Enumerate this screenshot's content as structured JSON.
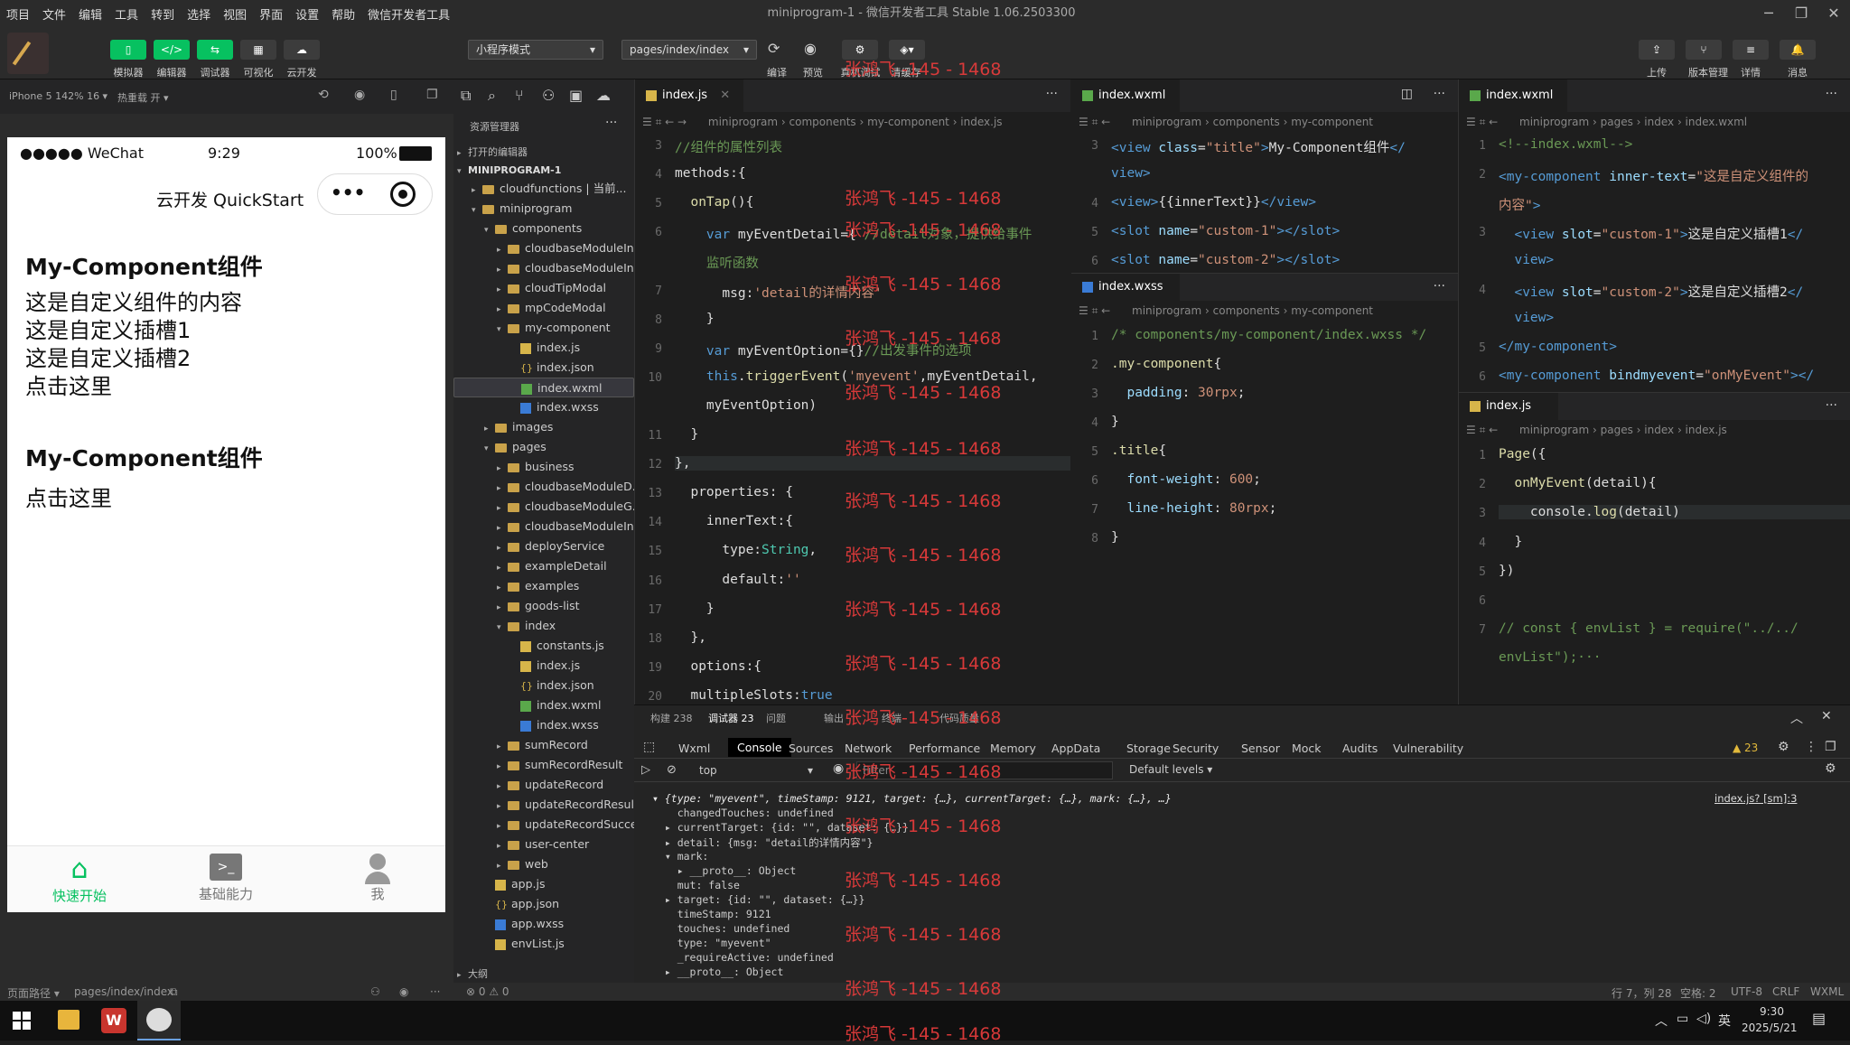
{
  "menu": [
    "项目",
    "文件",
    "编辑",
    "工具",
    "转到",
    "选择",
    "视图",
    "界面",
    "设置",
    "帮助",
    "微信开发者工具"
  ],
  "window_title": "miniprogram-1 - 微信开发者工具 Stable 1.06.2503300",
  "toolbar": {
    "simulator": "模拟器",
    "editor": "编辑器",
    "debugger": "调试器",
    "visual": "可视化",
    "cloud": "云开发",
    "mode": "小程序模式",
    "page": "pages/index/index",
    "compile": "编译",
    "preview": "预览",
    "real_debug": "真机调试",
    "clear_cache": "清缓存",
    "upload": "上传",
    "version": "版本管理",
    "details": "详情",
    "messages": "消息"
  },
  "subbar": {
    "device": "iPhone 5 142% 16 ▾",
    "hotreload": "热重载 开 ▾"
  },
  "phone": {
    "carrier": "●●●●● WeChat",
    "time": "9:29",
    "battery": "100%",
    "nav_title": "云开发 QuickStart",
    "comp1_title": "My-Component组件",
    "comp1_lines": [
      "这是自定义组件的内容",
      "这是自定义插槽1",
      "这是自定义插槽2",
      "点击这里"
    ],
    "comp2_title": "My-Component组件",
    "comp2_line": "点击这里",
    "tabs": [
      "快速开始",
      "基础能力",
      "我"
    ]
  },
  "explorer": {
    "title": "资源管理器",
    "open_editors": "打开的编辑器",
    "project": "MINIPROGRAM-1",
    "outline": "大纲",
    "items": [
      {
        "d": 1,
        "t": "folder",
        "n": "cloudfunctions | 当前...",
        "a": "▸"
      },
      {
        "d": 1,
        "t": "folder",
        "n": "miniprogram",
        "a": "▾"
      },
      {
        "d": 2,
        "t": "folder",
        "n": "components",
        "a": "▾"
      },
      {
        "d": 3,
        "t": "folder",
        "n": "cloudbaseModuleIn...",
        "a": "▸"
      },
      {
        "d": 3,
        "t": "folder",
        "n": "cloudbaseModuleIn...",
        "a": "▸"
      },
      {
        "d": 3,
        "t": "folder",
        "n": "cloudTipModal",
        "a": "▸"
      },
      {
        "d": 3,
        "t": "folder",
        "n": "mpCodeModal",
        "a": "▸"
      },
      {
        "d": 3,
        "t": "folder",
        "n": "my-component",
        "a": "▾"
      },
      {
        "d": 4,
        "t": "js",
        "n": "index.js"
      },
      {
        "d": 4,
        "t": "json",
        "n": "index.json"
      },
      {
        "d": 4,
        "t": "wxml",
        "n": "index.wxml",
        "s": true
      },
      {
        "d": 4,
        "t": "wxss",
        "n": "index.wxss"
      },
      {
        "d": 2,
        "t": "folder",
        "n": "images",
        "a": "▸"
      },
      {
        "d": 2,
        "t": "folder",
        "n": "pages",
        "a": "▾"
      },
      {
        "d": 3,
        "t": "folder",
        "n": "business",
        "a": "▸"
      },
      {
        "d": 3,
        "t": "folder",
        "n": "cloudbaseModuleD...",
        "a": "▸"
      },
      {
        "d": 3,
        "t": "folder",
        "n": "cloudbaseModuleG...",
        "a": "▸"
      },
      {
        "d": 3,
        "t": "folder",
        "n": "cloudbaseModuleIn...",
        "a": "▸"
      },
      {
        "d": 3,
        "t": "folder",
        "n": "deployService",
        "a": "▸"
      },
      {
        "d": 3,
        "t": "folder",
        "n": "exampleDetail",
        "a": "▸"
      },
      {
        "d": 3,
        "t": "folder",
        "n": "examples",
        "a": "▸"
      },
      {
        "d": 3,
        "t": "folder",
        "n": "goods-list",
        "a": "▸"
      },
      {
        "d": 3,
        "t": "folder",
        "n": "index",
        "a": "▾"
      },
      {
        "d": 4,
        "t": "js",
        "n": "constants.js"
      },
      {
        "d": 4,
        "t": "js",
        "n": "index.js"
      },
      {
        "d": 4,
        "t": "json",
        "n": "index.json"
      },
      {
        "d": 4,
        "t": "wxml",
        "n": "index.wxml"
      },
      {
        "d": 4,
        "t": "wxss",
        "n": "index.wxss"
      },
      {
        "d": 3,
        "t": "folder",
        "n": "sumRecord",
        "a": "▸"
      },
      {
        "d": 3,
        "t": "folder",
        "n": "sumRecordResult",
        "a": "▸"
      },
      {
        "d": 3,
        "t": "folder",
        "n": "updateRecord",
        "a": "▸"
      },
      {
        "d": 3,
        "t": "folder",
        "n": "updateRecordResult",
        "a": "▸"
      },
      {
        "d": 3,
        "t": "folder",
        "n": "updateRecordSuccess",
        "a": "▸"
      },
      {
        "d": 3,
        "t": "folder",
        "n": "user-center",
        "a": "▸"
      },
      {
        "d": 3,
        "t": "folder",
        "n": "web",
        "a": "▸"
      },
      {
        "d": 2,
        "t": "js",
        "n": "app.js"
      },
      {
        "d": 2,
        "t": "json",
        "n": "app.json"
      },
      {
        "d": 2,
        "t": "wxss",
        "n": "app.wxss"
      },
      {
        "d": 2,
        "t": "js",
        "n": "envList.js"
      }
    ]
  },
  "editor1": {
    "tab": "index.js",
    "crumb": "miniprogram › components › my-component › index.js",
    "lines": [
      {
        "n": "3",
        "h": "<span class='cm'>//组件的属性列表</span>"
      },
      {
        "n": "4",
        "h": "methods:{"
      },
      {
        "n": "5",
        "h": "  <span class='fn'>onTap</span>(){"
      },
      {
        "n": "6",
        "h": "    <span class='kw'>var</span> myEventDetail={ <span class='cm'>//detail对象，提供给事件</span>"
      },
      {
        "n": "",
        "h": "    <span class='cm'>监听函数</span>"
      },
      {
        "n": "7",
        "h": "      msg:<span class='str'>'detail的详情内容'</span>"
      },
      {
        "n": "8",
        "h": "    }"
      },
      {
        "n": "9",
        "h": "    <span class='kw'>var</span> myEventOption={}<span class='cm'>//出发事件的选项</span>"
      },
      {
        "n": "10",
        "h": "    <span class='kw'>this</span>.<span class='fn'>triggerEvent</span>(<span class='str'>'myevent'</span>,myEventDetail,"
      },
      {
        "n": "",
        "h": "    myEventOption)"
      },
      {
        "n": "11",
        "h": "  }"
      },
      {
        "n": "12",
        "h": "},"
      },
      {
        "n": "13",
        "h": "  properties: {"
      },
      {
        "n": "14",
        "h": "    innerText:{"
      },
      {
        "n": "15",
        "h": "      type:<span class='fnc'>String</span>,"
      },
      {
        "n": "16",
        "h": "      default:<span class='str'>''</span>"
      },
      {
        "n": "17",
        "h": "    }"
      },
      {
        "n": "18",
        "h": "  },"
      },
      {
        "n": "19",
        "h": "  options:{"
      },
      {
        "n": "20",
        "h": "  multipleSlots:<span class='kw'>true</span>"
      }
    ]
  },
  "editor2": {
    "tab": "index.wxml",
    "crumb": "miniprogram › components › my-component",
    "lines": [
      {
        "n": "3",
        "h": "<span class='tag'>&lt;view</span> <span class='attr'>class</span>=<span class='str'>\"title\"</span><span class='tag'>&gt;</span>My-Component组件<span class='tag'>&lt;/</span>"
      },
      {
        "n": "",
        "h": "<span class='tag'>view&gt;</span>"
      },
      {
        "n": "4",
        "h": "<span class='tag'>&lt;view&gt;</span>{{innerText}}<span class='tag'>&lt;/view&gt;</span>"
      },
      {
        "n": "5",
        "h": "<span class='tag'>&lt;slot</span> <span class='attr'>name</span>=<span class='str'>\"custom-1\"</span><span class='tag'>&gt;&lt;/slot&gt;</span>"
      },
      {
        "n": "6",
        "h": "<span class='tag'>&lt;slot</span> <span class='attr'>name</span>=<span class='str'>\"custom-2\"</span><span class='tag'>&gt;&lt;/slot&gt;</span>"
      }
    ]
  },
  "editor3": {
    "tab": "index.wxss",
    "crumb": "miniprogram › components › my-component",
    "lines": [
      {
        "n": "1",
        "h": "<span class='cm'>/* components/my-component/index.wxss */</span>"
      },
      {
        "n": "2",
        "h": "<span class='fn'>.my-component</span>{"
      },
      {
        "n": "3",
        "h": "  <span class='attr'>padding</span>: <span class='str'>30rpx</span>;"
      },
      {
        "n": "4",
        "h": "}"
      },
      {
        "n": "5",
        "h": "<span class='fn'>.title</span>{"
      },
      {
        "n": "6",
        "h": "  <span class='attr'>font-weight</span>: <span class='str'>600</span>;"
      },
      {
        "n": "7",
        "h": "  <span class='attr'>line-height</span>: <span class='str'>80rpx</span>;"
      },
      {
        "n": "8",
        "h": "}"
      }
    ]
  },
  "editor4": {
    "tab": "index.wxml",
    "crumb": "miniprogram › pages › index › index.wxml",
    "lines": [
      {
        "n": "1",
        "h": "<span class='cm'>&lt;!--index.wxml--&gt;</span>"
      },
      {
        "n": "2",
        "h": "<span class='tag'>&lt;my-component</span> <span class='attr'>inner-text</span>=<span class='str'>\"这是自定义组件的</span>"
      },
      {
        "n": "",
        "h": "<span class='str'>内容\"</span><span class='tag'>&gt;</span>"
      },
      {
        "n": "3",
        "h": "  <span class='tag'>&lt;view</span> <span class='attr'>slot</span>=<span class='str'>\"custom-1\"</span><span class='tag'>&gt;</span>这是自定义插槽1<span class='tag'>&lt;/</span>"
      },
      {
        "n": "",
        "h": "  <span class='tag'>view&gt;</span>"
      },
      {
        "n": "4",
        "h": "  <span class='tag'>&lt;view</span> <span class='attr'>slot</span>=<span class='str'>\"custom-2\"</span><span class='tag'>&gt;</span>这是自定义插槽2<span class='tag'>&lt;/</span>"
      },
      {
        "n": "",
        "h": "  <span class='tag'>view&gt;</span>"
      },
      {
        "n": "5",
        "h": "<span class='tag'>&lt;/my-component&gt;</span>"
      },
      {
        "n": "6",
        "h": "<span class='tag'>&lt;my-component</span> <span class='attr'>bindmyevent</span>=<span class='str'>\"onMyEvent\"</span><span class='tag'>&gt;&lt;/</span>"
      }
    ]
  },
  "editor5": {
    "tab": "index.js",
    "crumb": "miniprogram › pages › index › index.js",
    "lines": [
      {
        "n": "1",
        "h": "<span class='fn'>Page</span>({"
      },
      {
        "n": "2",
        "h": "  <span class='fn'>onMyEvent</span>(detail){"
      },
      {
        "n": "3",
        "h": "    console.<span class='fn'>log</span>(detail)"
      },
      {
        "n": "4",
        "h": "  }"
      },
      {
        "n": "5",
        "h": "})"
      },
      {
        "n": "6",
        "h": ""
      },
      {
        "n": "7",
        "h": "<span class='cm'>// const { envList } = require(\"../../</span>"
      },
      {
        "n": "",
        "h": "<span class='cm'>envList\");···</span>"
      }
    ]
  },
  "devtools": {
    "top_tabs": [
      "构建 238",
      "调试器 23",
      "问题",
      "输出",
      "终端",
      "代码质量"
    ],
    "tabs": [
      "Wxml",
      "Console",
      "Sources",
      "Network",
      "Performance",
      "Memory",
      "AppData",
      "Storage",
      "Security",
      "Sensor",
      "Mock",
      "Audits",
      "Vulnerability"
    ],
    "warn_count": "▲ 23",
    "context": "top",
    "filter": "Filter",
    "levels": "Default levels ▾",
    "source_link": "index.js? [sm]:3",
    "console": [
      "▾ {type: \"myevent\", timeStamp: 9121, target: {…}, currentTarget: {…}, mark: {…}, …}",
      "    changedTouches: undefined",
      "  ▸ currentTarget: {id: \"\", dataset: {…}}",
      "  ▸ detail: {msg: \"detail的详情内容\"}",
      "  ▾ mark:",
      "    ▸ __proto__: Object",
      "    mut: false",
      "  ▸ target: {id: \"\", dataset: {…}}",
      "    timeStamp: 9121",
      "    touches: undefined",
      "    type: \"myevent\"",
      "    _requireActive: undefined",
      "  ▸ __proto__: Object"
    ]
  },
  "statusbar": {
    "path_label": "页面路径 ▾",
    "path": "pages/index/index",
    "errors": "⊗ 0 ⚠ 0",
    "cursor": "行 7，列 28",
    "spaces": "空格: 2",
    "encoding": "UTF-8",
    "eol": "CRLF",
    "lang": "WXML"
  },
  "taskbar": {
    "ime": "英",
    "time": "9:30",
    "date": "2025/5/21"
  },
  "watermark": "张鸿飞 -145 - 1468"
}
